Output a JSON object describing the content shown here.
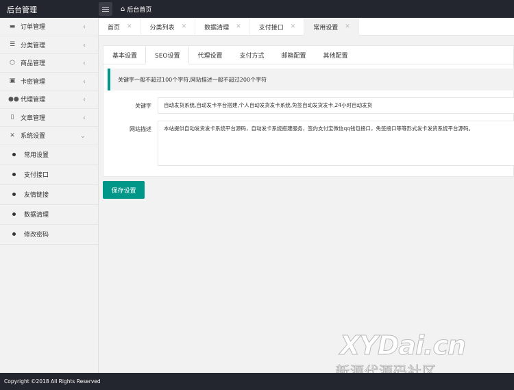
{
  "header": {
    "title": "后台管理",
    "menu_icon": "hamburger-icon",
    "home_icon": "home-icon",
    "home_label": "后台首页"
  },
  "sidebar": {
    "items": [
      {
        "label": "订单管理",
        "icon": "order-icon",
        "glyph": "▬"
      },
      {
        "label": "分类管理",
        "icon": "list-icon",
        "glyph": "☰"
      },
      {
        "label": "商品管理",
        "icon": "cube-icon",
        "glyph": "⬡"
      },
      {
        "label": "卡密管理",
        "icon": "card-icon",
        "glyph": "▣"
      },
      {
        "label": "代理管理",
        "icon": "users-icon",
        "glyph": "👥"
      },
      {
        "label": "文章管理",
        "icon": "document-icon",
        "glyph": "▯"
      },
      {
        "label": "系统设置",
        "icon": "tools-icon",
        "glyph": "✕"
      }
    ],
    "subitems": [
      {
        "label": "常用设置"
      },
      {
        "label": "支付接口"
      },
      {
        "label": "友情链接"
      },
      {
        "label": "数据清理"
      },
      {
        "label": "修改密码"
      }
    ]
  },
  "tabs": [
    {
      "label": "首页"
    },
    {
      "label": "分类列表"
    },
    {
      "label": "数据清理"
    },
    {
      "label": "支付接口"
    },
    {
      "label": "常用设置",
      "active": true
    }
  ],
  "subtabs": [
    {
      "label": "基本设置"
    },
    {
      "label": "SEO设置",
      "active": true
    },
    {
      "label": "代理设置"
    },
    {
      "label": "支付方式"
    },
    {
      "label": "邮箱配置"
    },
    {
      "label": "其他配置"
    }
  ],
  "notice": "关键字一般不超过100个字符,网站描述一般不超过200个字符",
  "form": {
    "keywords_label": "关键字",
    "keywords_value": "自动发货系统,自动发卡平台搭建,个人自动发货发卡系统,免签自动发货发卡,24小时自动发货",
    "description_label": "网站描述",
    "description_value": "本站提供自动发货发卡系统平台源码，自动发卡系统搭建服务，签约支付宝微信qq钱包接口，免签接口等等形式发卡发货系统平台源码。"
  },
  "save_button": "保存设置",
  "footer": "Copyright ©2018 All Rights Reserved",
  "watermark": {
    "main": "XYDai.cn",
    "sub": "新源代源码社区"
  },
  "colors": {
    "topbar": "#23262e",
    "accent": "#009688",
    "background": "#f2f2f2"
  }
}
